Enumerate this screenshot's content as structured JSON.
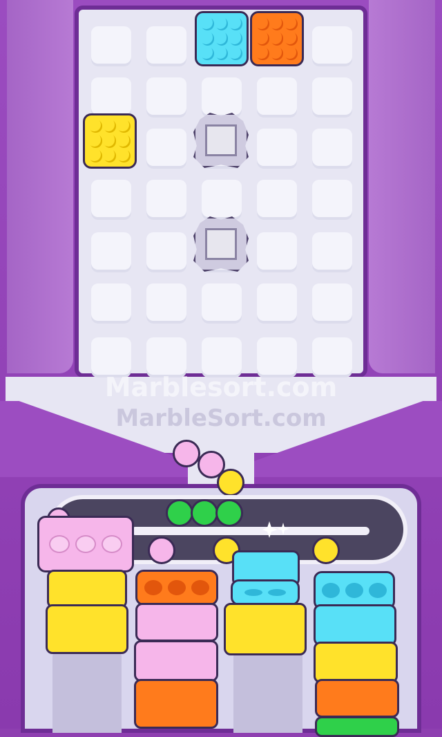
{
  "watermark": {
    "line1": "Marblesort.com",
    "line2": "MarbleSort.com"
  },
  "colors": {
    "board": "#e7e6f3",
    "frame": "#8e3fb0",
    "pink": "#f6b6ea",
    "yellow": "#ffe22b",
    "orange": "#ff7b1c",
    "cyan": "#58e0f7",
    "green": "#2fd04a"
  },
  "grid": {
    "rows": 7,
    "cols": 5
  },
  "board_boxes": [
    {
      "color": "cyan",
      "row": 0,
      "col": 2
    },
    {
      "color": "orange",
      "row": 0,
      "col": 3
    },
    {
      "color": "yellow",
      "row": 2,
      "col": 0
    }
  ],
  "obstacles": [
    {
      "type": "stone-block",
      "row": 2,
      "col": 2
    },
    {
      "type": "stone-block",
      "row": 4,
      "col": 2
    }
  ],
  "queue_marbles": [
    "pink",
    "pink",
    "yellow"
  ],
  "conveyor_marbles": [
    "pink",
    "pink",
    "pink",
    "green",
    "green",
    "green",
    "yellow",
    "yellow"
  ],
  "columns": [
    {
      "holder": "pink",
      "stack": [
        "yellow",
        "yellow"
      ]
    },
    {
      "holder": "orange",
      "stack": [
        "pink",
        "pink",
        "orange"
      ]
    },
    {
      "holder": "cyan",
      "stack": [
        "cyan",
        "yellow"
      ]
    },
    {
      "holder": "cyan",
      "stack": [
        "cyan",
        "yellow",
        "orange",
        "green"
      ]
    }
  ]
}
